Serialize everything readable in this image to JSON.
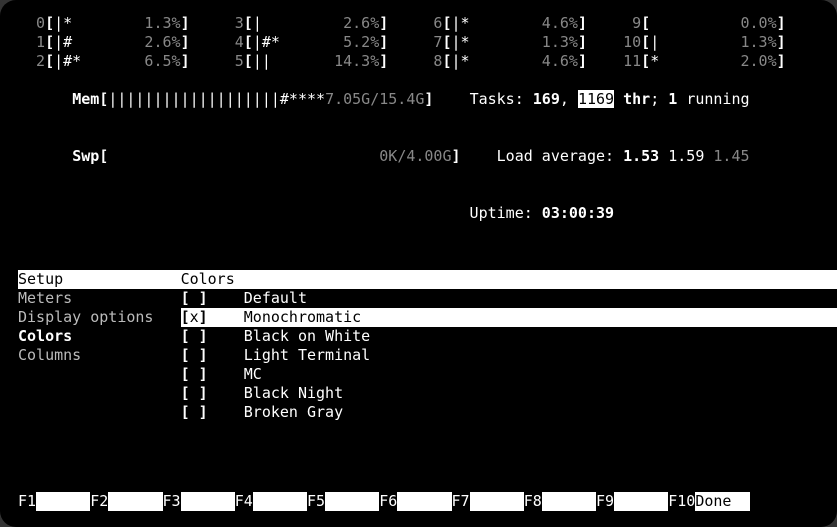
{
  "cpu": [
    {
      "id": "0",
      "bar": "|*       ",
      "pct": "1.3%"
    },
    {
      "id": "1",
      "bar": "|#       ",
      "pct": "2.6%"
    },
    {
      "id": "2",
      "bar": "|#*      ",
      "pct": "6.5%"
    },
    {
      "id": "3",
      "bar": "|        ",
      "pct": "2.6%"
    },
    {
      "id": "4",
      "bar": "|#*      ",
      "pct": "5.2%"
    },
    {
      "id": "5",
      "bar": "||       ",
      "pct": "14.3%"
    },
    {
      "id": "6",
      "bar": "|*       ",
      "pct": "4.6%"
    },
    {
      "id": "7",
      "bar": "|*       ",
      "pct": "1.3%"
    },
    {
      "id": "8",
      "bar": "|*       ",
      "pct": "4.6%"
    },
    {
      "id": "9",
      "bar": "         ",
      "pct": "0.0%"
    },
    {
      "id": "10",
      "bar": "|        ",
      "pct": "1.3%"
    },
    {
      "id": "11",
      "bar": "*        ",
      "pct": "2.0%"
    }
  ],
  "mem": {
    "label": "Mem",
    "bar": "|||||||||||||||||||#****",
    "used": "7.05G",
    "total": "15.4G"
  },
  "swp": {
    "label": "Swp",
    "used": "0K",
    "total": "4.00G"
  },
  "tasks": {
    "label": "Tasks:",
    "count": "169",
    "thr": "1169",
    "thr_label": "thr",
    "running": "1",
    "running_label": "running"
  },
  "load": {
    "label": "Load average:",
    "l1": "1.53",
    "l2": "1.59",
    "l3": "1.45"
  },
  "uptime": {
    "label": "Uptime:",
    "value": "03:00:39"
  },
  "setup": {
    "left_title": "Setup",
    "right_title": "Colors",
    "menu": [
      "Meters",
      "Display options",
      "Colors",
      "Columns"
    ],
    "selected_menu": "Colors",
    "options": [
      {
        "checked": false,
        "label": "Default"
      },
      {
        "checked": true,
        "label": "Monochromatic"
      },
      {
        "checked": false,
        "label": "Black on White"
      },
      {
        "checked": false,
        "label": "Light Terminal"
      },
      {
        "checked": false,
        "label": "MC"
      },
      {
        "checked": false,
        "label": "Black Night"
      },
      {
        "checked": false,
        "label": "Broken Gray"
      }
    ],
    "selected_option": "Monochromatic"
  },
  "footer": {
    "keys": [
      "F1",
      "F2",
      "F3",
      "F4",
      "F5",
      "F6",
      "F7",
      "F8",
      "F9",
      "F10"
    ],
    "labels": [
      "      ",
      "      ",
      "      ",
      "      ",
      "      ",
      "      ",
      "      ",
      "      ",
      "      ",
      "Done"
    ]
  }
}
